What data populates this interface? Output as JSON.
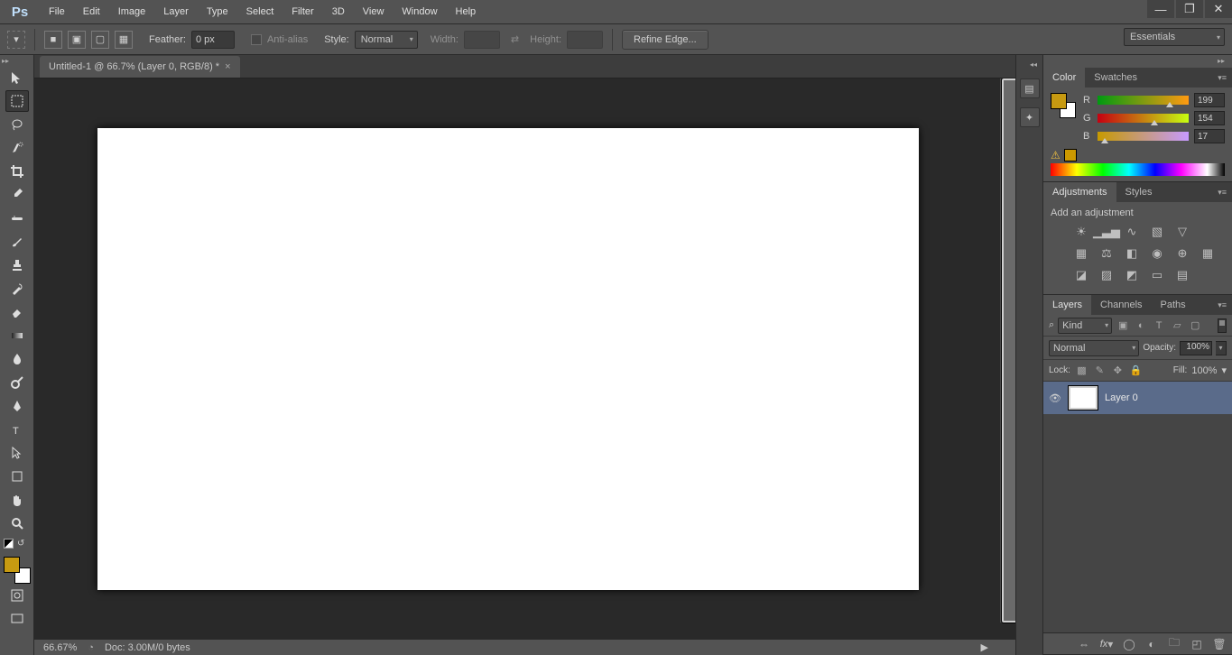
{
  "menu": [
    "File",
    "Edit",
    "Image",
    "Layer",
    "Type",
    "Select",
    "Filter",
    "3D",
    "View",
    "Window",
    "Help"
  ],
  "options": {
    "feather_label": "Feather:",
    "feather_value": "0 px",
    "antialias": "Anti-alias",
    "style_label": "Style:",
    "style_value": "Normal",
    "width_label": "Width:",
    "height_label": "Height:",
    "refine": "Refine Edge..."
  },
  "workspace": "Essentials",
  "doc_tab": "Untitled-1 @ 66.7% (Layer 0, RGB/8) *",
  "status": {
    "zoom": "66.67%",
    "doc": "Doc: 3.00M/0 bytes"
  },
  "color": {
    "tab_color": "Color",
    "tab_swatches": "Swatches",
    "r_label": "R",
    "r_value": "199",
    "g_label": "G",
    "g_value": "154",
    "b_label": "B",
    "b_value": "17",
    "fg": "#c79a11",
    "bg": "#ffffff",
    "safe": "#cc9900"
  },
  "adjustments": {
    "tab_adj": "Adjustments",
    "tab_styles": "Styles",
    "title": "Add an adjustment"
  },
  "layers": {
    "tab_layers": "Layers",
    "tab_channels": "Channels",
    "tab_paths": "Paths",
    "filter_kind": "Kind",
    "blend_mode": "Normal",
    "opacity_label": "Opacity:",
    "opacity": "100%",
    "lock_label": "Lock:",
    "fill_label": "Fill:",
    "fill": "100%",
    "layer0": "Layer 0"
  }
}
